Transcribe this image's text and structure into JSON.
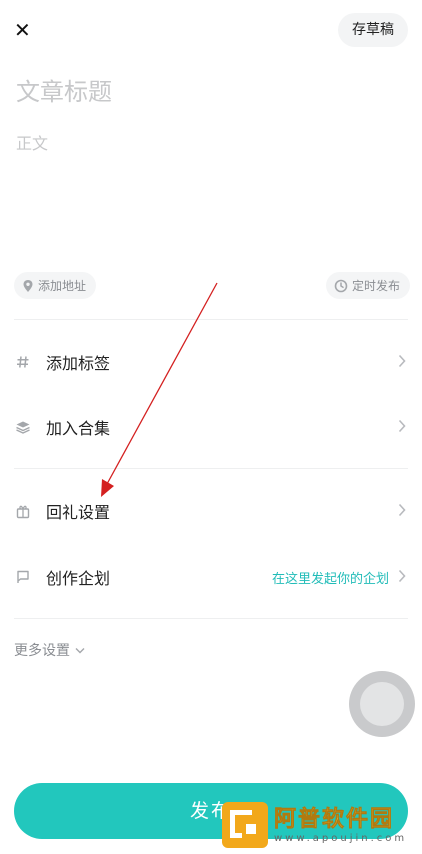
{
  "header": {
    "close_label": "✕",
    "draft_label": "存草稿"
  },
  "editor": {
    "title_placeholder": "文章标题",
    "body_placeholder": "正文"
  },
  "chips": {
    "location": "添加地址",
    "schedule": "定时发布"
  },
  "menu": {
    "tags": "添加标签",
    "collection": "加入合集",
    "gift_settings": "回礼设置",
    "creation_plan": "创作企划",
    "creation_plan_hint": "在这里发起你的企划"
  },
  "more_settings": "更多设置",
  "publish_label": "发布",
  "watermark": {
    "title": "阿普软件园",
    "url": "www.apoujin.com"
  },
  "colors": {
    "accent": "#22c7bd",
    "hint": "#21bcb8",
    "annotation_arrow": "#d42020",
    "watermark": "#f2a81b"
  },
  "icons": {
    "close": "close-icon",
    "location": "location-pin-icon",
    "schedule": "clock-icon",
    "tags": "hashtag-icon",
    "collection": "layers-icon",
    "gift": "gift-icon",
    "plan": "flag-icon",
    "chevron": "chevron-right-icon",
    "more": "chevron-down-icon"
  }
}
